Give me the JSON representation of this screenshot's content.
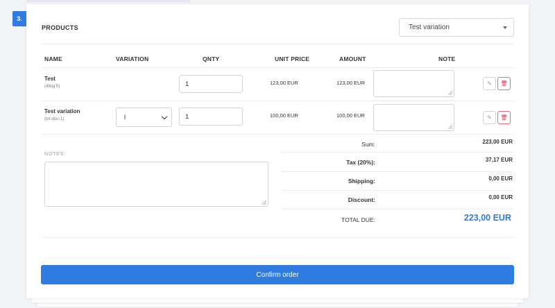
{
  "step": {
    "number": "3."
  },
  "products": {
    "title": "PRODUCTS",
    "variation_select": {
      "value": "Test variation"
    }
  },
  "table": {
    "headers": {
      "name": "NAME",
      "variation": "VARIATION",
      "qnty": "QNTY",
      "unit_price": "UNIT PRICE",
      "amount": "AMOUNT",
      "note": "NOTE"
    },
    "rows": [
      {
        "name": "Test",
        "code": "(49ngTl)",
        "variation": "",
        "qty": "1",
        "unit_price": "123,00 EUR",
        "amount": "123,00 EUR",
        "note": ""
      },
      {
        "name": "Test variation",
        "code": "(txt-disc-1)",
        "variation": "l",
        "qty": "1",
        "unit_price": "100,00 EUR",
        "amount": "100,00 EUR",
        "note": ""
      }
    ]
  },
  "notes": {
    "label": "NOTES:",
    "value": ""
  },
  "summary": {
    "sum_label": "Sum:",
    "sum_value": "223,00 EUR",
    "tax_label": "Tax (20%):",
    "tax_value": "37,17 EUR",
    "shipping_label": "Shipping:",
    "shipping_value": "0,00 EUR",
    "discount_label": "Discount:",
    "discount_value": "0,00 EUR",
    "total_label": "TOTAL DUE:",
    "total_value": "223,00 EUR"
  },
  "confirm": {
    "label": "Confirm order"
  },
  "colors": {
    "accent": "#2f7be0",
    "danger": "#dc3545"
  },
  "icons": {
    "edit": "pencil-icon",
    "delete": "trash-icon"
  }
}
